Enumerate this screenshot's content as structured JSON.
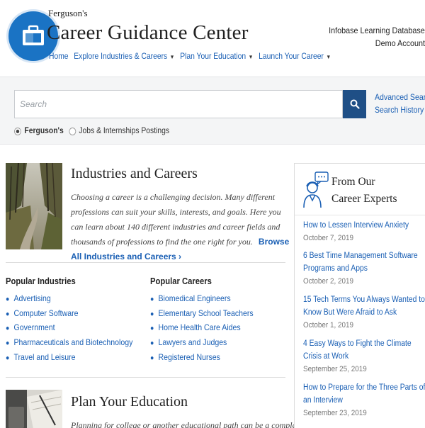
{
  "brand": {
    "small": "Ferguson's",
    "title": "Career Guidance Center"
  },
  "nav": [
    {
      "label": "Home",
      "dropdown": false
    },
    {
      "label": "Explore Industries & Careers",
      "dropdown": true
    },
    {
      "label": "Plan Your Education",
      "dropdown": true
    },
    {
      "label": "Launch Your Career",
      "dropdown": true
    }
  ],
  "account": {
    "database": "Infobase Learning Database",
    "name": "Demo Account"
  },
  "search": {
    "placeholder": "Search",
    "advanced": "Advanced Search",
    "history": "Search History",
    "scope_options": [
      "Ferguson's",
      "Jobs & Internships Postings"
    ],
    "scope_selected": "Ferguson's"
  },
  "industries_section": {
    "title": "Industries and Careers",
    "description": "Choosing a career is a challenging decision. Many different professions can suit your skills, interests, and goals. Here you can learn about 140 different industries and career fields and thousands of professions to find the one right for you.",
    "browse_link": "Browse All Industries and Careers ›"
  },
  "popular_industries": {
    "heading": "Popular Industries",
    "items": [
      "Advertising",
      "Computer Software",
      "Government",
      "Pharmaceuticals and Biotechnology",
      "Travel and Leisure"
    ]
  },
  "popular_careers": {
    "heading": "Popular Careers",
    "items": [
      "Biomedical Engineers",
      "Elementary School Teachers",
      "Home Health Care Aides",
      "Lawyers and Judges",
      "Registered Nurses"
    ]
  },
  "education_section": {
    "title": "Plan Your Education",
    "description": "Planning for college or another educational path can be a complex process."
  },
  "experts": {
    "title_line1": "From Our",
    "title_line2": "Career Experts",
    "articles": [
      {
        "title": "How to Lessen Interview Anxiety",
        "date": "October 7, 2019"
      },
      {
        "title": "6 Best Time Management Software Programs and Apps",
        "date": "October 2, 2019"
      },
      {
        "title": "15 Tech Terms You Always Wanted to Know But Were Afraid to Ask",
        "date": "October 1, 2019"
      },
      {
        "title": "4 Easy Ways to Fight the Climate Crisis at Work",
        "date": "September 25, 2019"
      },
      {
        "title": "How to Prepare for the Three Parts of an Interview",
        "date": "September 23, 2019"
      }
    ]
  },
  "colors": {
    "link": "#1a5fb4",
    "search_button": "#1f4f86",
    "logo": "#1a73c4"
  }
}
